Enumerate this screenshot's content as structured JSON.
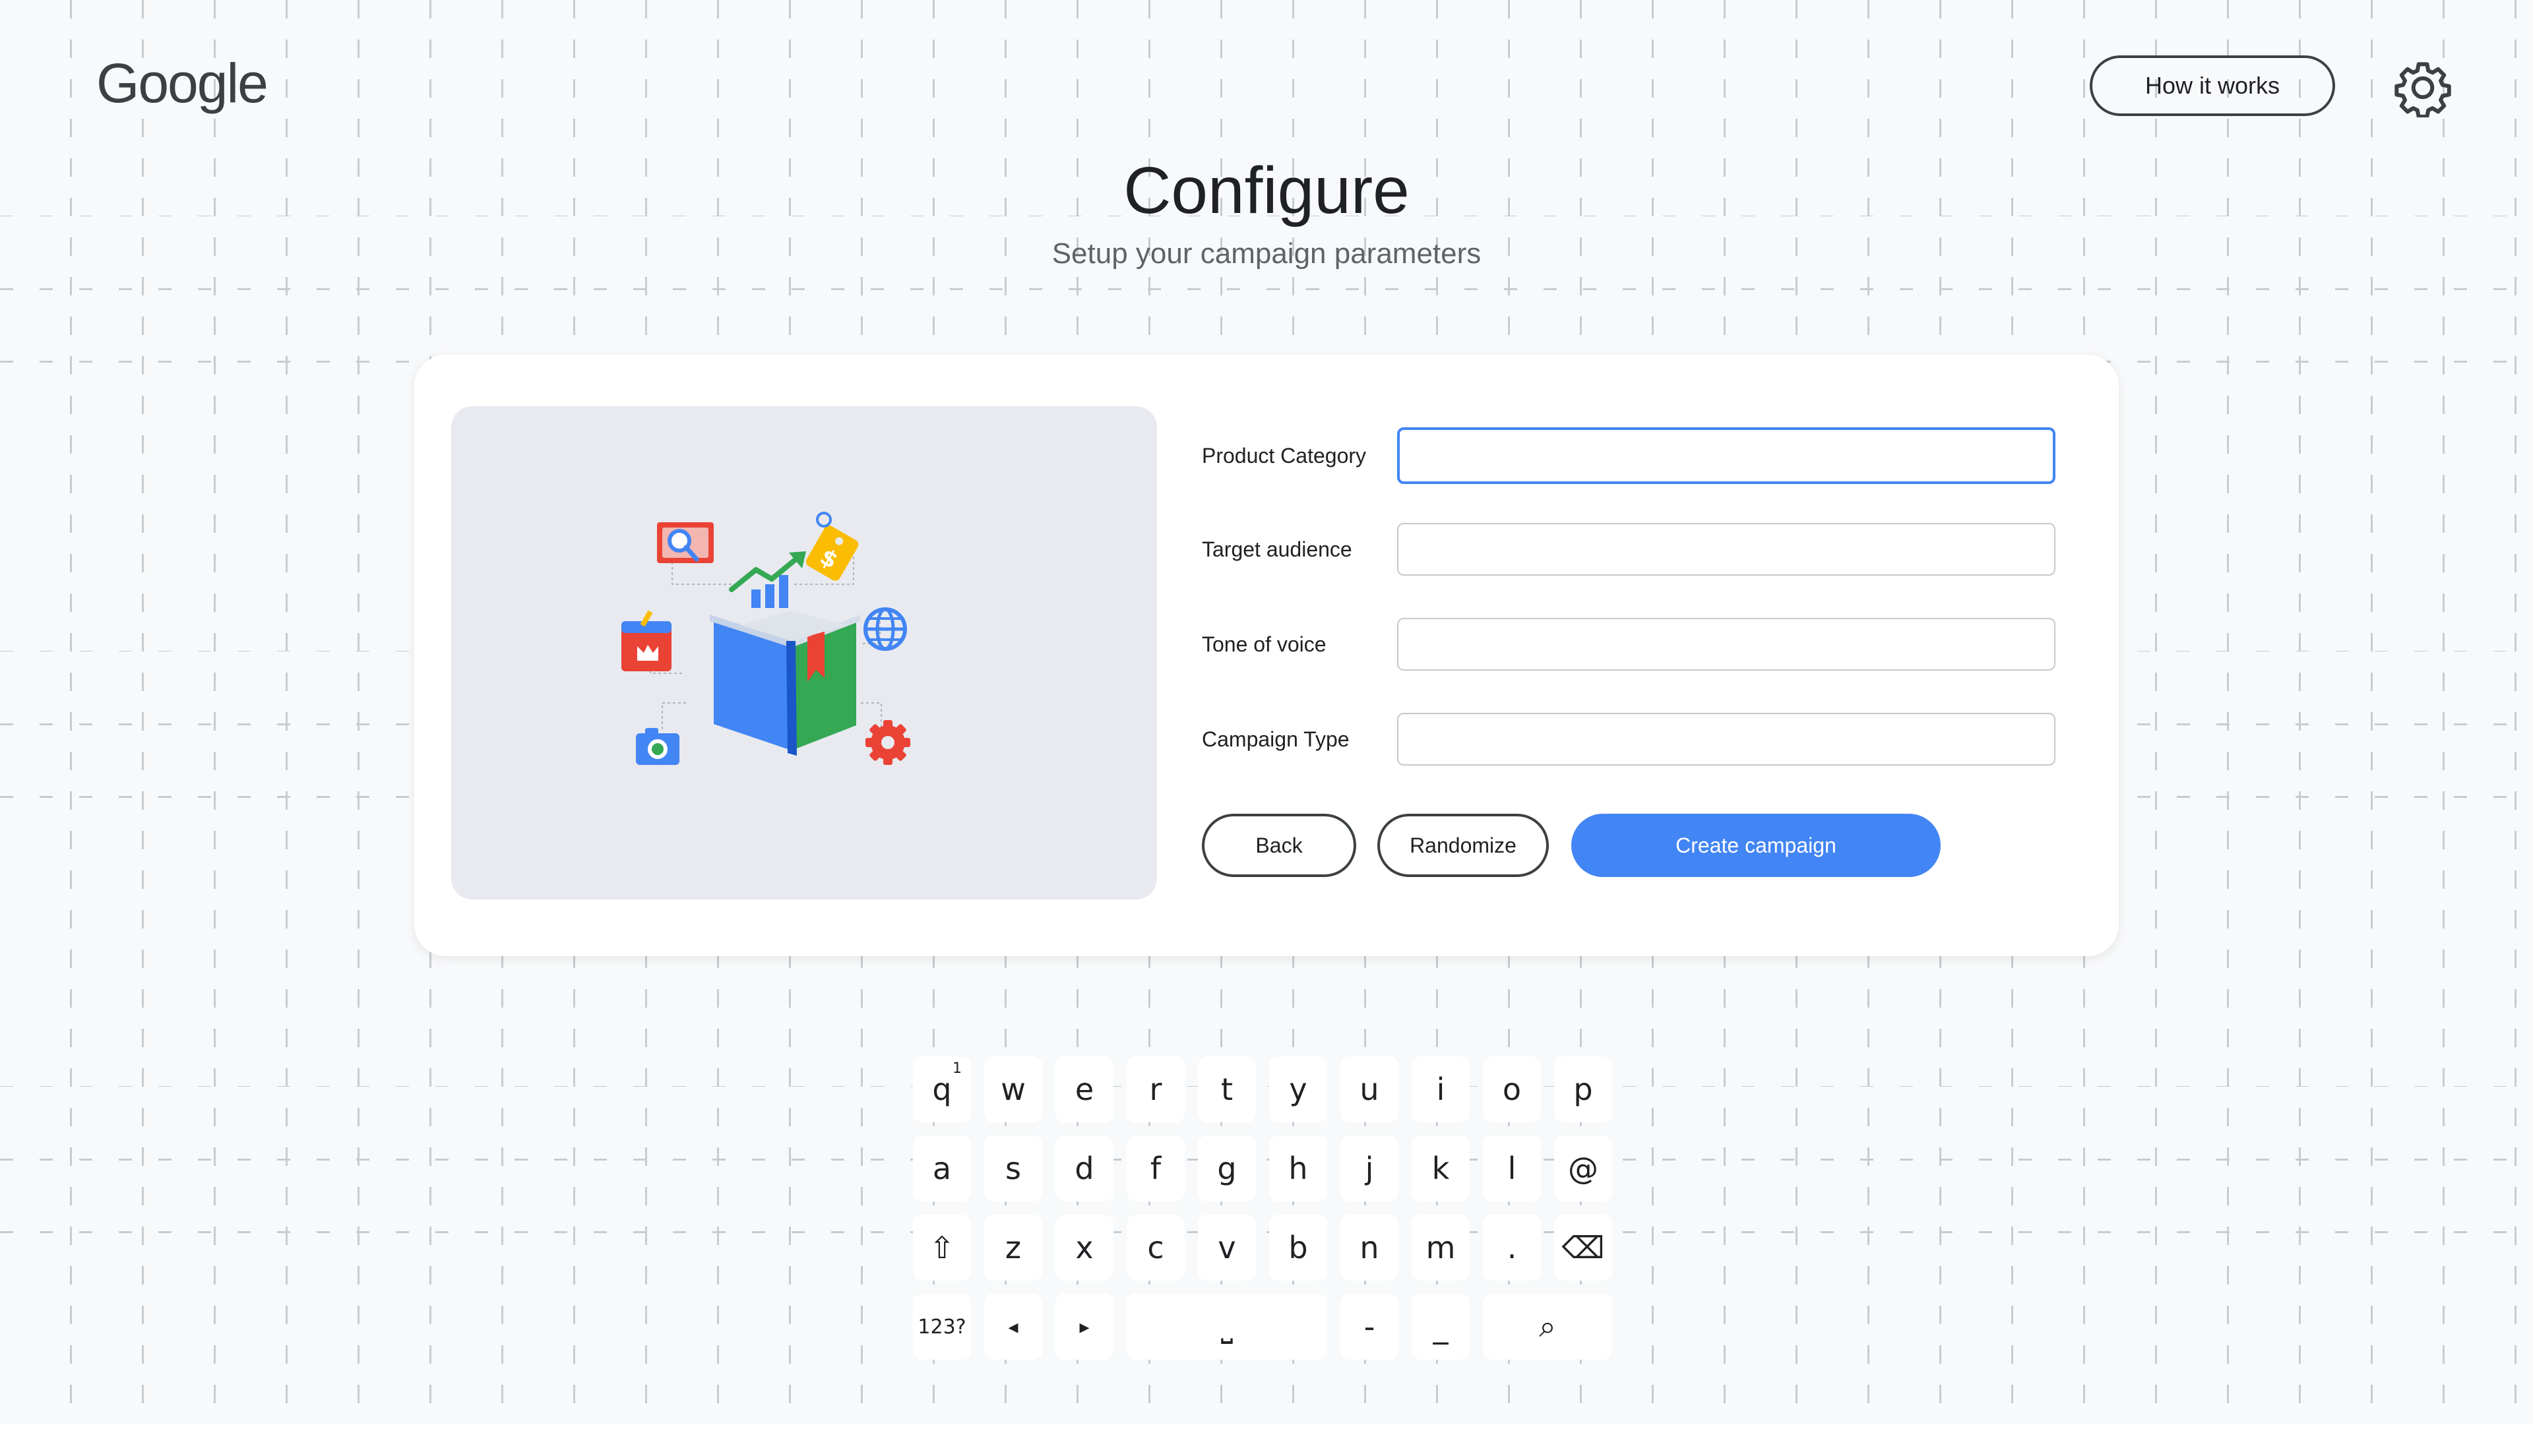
{
  "header": {
    "logo_text": "Google",
    "how_it_works": "How it works",
    "settings_icon": "gear-icon"
  },
  "page": {
    "title": "Configure",
    "subtitle": "Setup your campaign parameters"
  },
  "form": {
    "fields": [
      {
        "label": "Product Category",
        "value": "",
        "focused": true
      },
      {
        "label": "Target audience",
        "value": ""
      },
      {
        "label": "Tone of voice",
        "value": ""
      },
      {
        "label": "Campaign Type",
        "value": ""
      }
    ],
    "back_label": "Back",
    "randomize_label": "Randomize",
    "create_label": "Create campaign"
  },
  "keyboard": {
    "row1": [
      "q",
      "w",
      "e",
      "r",
      "t",
      "y",
      "u",
      "i",
      "o",
      "p"
    ],
    "row1_hint": "1",
    "row2": [
      "a",
      "s",
      "d",
      "f",
      "g",
      "h",
      "j",
      "k",
      "l",
      "@"
    ],
    "row3": [
      "⇧",
      "z",
      "x",
      "c",
      "v",
      "b",
      "n",
      "m",
      ".",
      "⌫"
    ],
    "row4": [
      "123?",
      "◂",
      "▸",
      "⎵",
      "-",
      "_",
      "⌕"
    ]
  },
  "colors": {
    "accent": "#4285f4",
    "background": "#f8f9fa",
    "text": "#202124"
  }
}
